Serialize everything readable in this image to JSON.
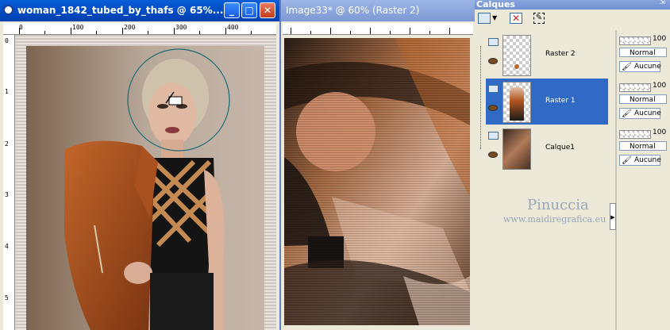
{
  "window1": {
    "title": "woman_1842_tubed_by_thafs @  65%...",
    "ruler_h": [
      "0",
      "100",
      "200",
      "300",
      "400"
    ],
    "ruler_v": [
      "0",
      "1",
      "2",
      "3",
      "4",
      "5"
    ],
    "buttons": {
      "minimize": "_",
      "maximize": "□",
      "close": "✕"
    }
  },
  "window2": {
    "title": "Image33* @  60% (Raster 2)"
  },
  "layers_panel": {
    "title": "Calques",
    "layers": [
      {
        "name": "Raster 2",
        "opacity": "100",
        "blend": "Normal",
        "mask": "Aucune",
        "selected": false
      },
      {
        "name": "Raster 1",
        "opacity": "100",
        "blend": "Normal",
        "mask": "Aucune",
        "selected": true
      },
      {
        "name": "Calque1",
        "opacity": "100",
        "blend": "Normal",
        "mask": "Aucune",
        "selected": false
      }
    ]
  },
  "watermark": {
    "name": "Pinuccia",
    "url": "www.maidiregrafica.eu"
  },
  "colors": {
    "titlebar_active": "#0050c8",
    "selection": "#316ac5",
    "panel_bg": "#ece9d8"
  }
}
